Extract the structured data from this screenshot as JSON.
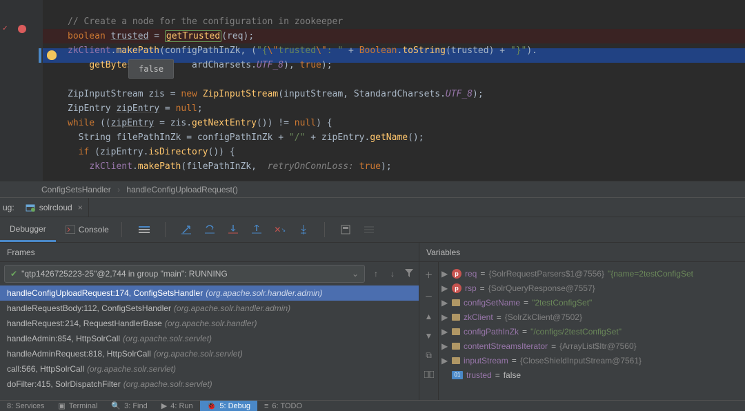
{
  "tooltip": "false",
  "breadcrumb": {
    "a": "ConfigSetsHandler",
    "b": "handleConfigUploadRequest()"
  },
  "debug_label": "ug:",
  "run_tab": "solrcloud",
  "tool_tabs": {
    "debugger": "Debugger",
    "console": "Console"
  },
  "frames_title": "Frames",
  "variables_title": "Variables",
  "thread": "\"qtp1426725223-25\"@2,744 in group \"main\": RUNNING",
  "frames": [
    {
      "m": "handleConfigUploadRequest:174, ConfigSetsHandler",
      "p": "(org.apache.solr.handler.admin)"
    },
    {
      "m": "handleRequestBody:112, ConfigSetsHandler",
      "p": "(org.apache.solr.handler.admin)"
    },
    {
      "m": "handleRequest:214, RequestHandlerBase",
      "p": "(org.apache.solr.handler)"
    },
    {
      "m": "handleAdmin:854, HttpSolrCall",
      "p": "(org.apache.solr.servlet)"
    },
    {
      "m": "handleAdminRequest:818, HttpSolrCall",
      "p": "(org.apache.solr.servlet)"
    },
    {
      "m": "call:566, HttpSolrCall",
      "p": "(org.apache.solr.servlet)"
    },
    {
      "m": "doFilter:415, SolrDispatchFilter",
      "p": "(org.apache.solr.servlet)"
    }
  ],
  "vars": [
    {
      "t": "p",
      "n": "req",
      "eq": " = ",
      "v": "{SolrRequestParsers$1@7556}",
      "s": " \"{name=2testConfigSet"
    },
    {
      "t": "p",
      "n": "rsp",
      "eq": " = ",
      "v": "{SolrQueryResponse@7557}",
      "s": ""
    },
    {
      "t": "f",
      "n": "configSetName",
      "eq": " = ",
      "v": "",
      "s": "\"2testConfigSet\""
    },
    {
      "t": "f",
      "n": "zkClient",
      "eq": " = ",
      "v": "{SolrZkClient@7502}",
      "s": ""
    },
    {
      "t": "f",
      "n": "configPathInZk",
      "eq": " = ",
      "v": "",
      "s": "\"/configs/2testConfigSet\""
    },
    {
      "t": "f",
      "n": "contentStreamsIterator",
      "eq": " = ",
      "v": "{ArrayList$Itr@7560}",
      "s": ""
    },
    {
      "t": "f",
      "n": "inputStream",
      "eq": " = ",
      "v": "{CloseShieldInputStream@7561}",
      "s": ""
    },
    {
      "t": "01",
      "n": "trusted",
      "eq": " = ",
      "v": "false",
      "s": ""
    }
  ],
  "statusbar": {
    "services": "8: Services",
    "terminal": "Terminal",
    "find": "3: Find",
    "run": "4: Run",
    "debug": "5: Debug",
    "todo": "6: TODO"
  },
  "chart_data": null
}
